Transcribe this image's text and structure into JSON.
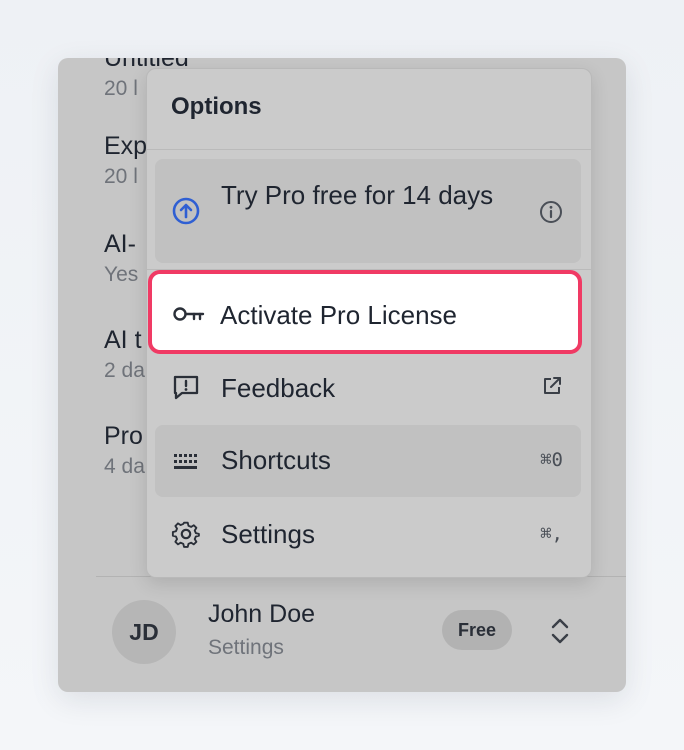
{
  "background_list": {
    "items": [
      {
        "title": "Untitled",
        "meta": "20 l"
      },
      {
        "title": "Exp",
        "meta": "20 l"
      },
      {
        "title": "AI-",
        "meta": "Yes"
      },
      {
        "title": "AI t",
        "meta": "2 da"
      },
      {
        "title": "Pro",
        "meta": "4 da"
      }
    ]
  },
  "user": {
    "initials": "JD",
    "name": "John Doe",
    "subtitle": "Settings",
    "plan": "Free"
  },
  "menu": {
    "header": "Options",
    "items": [
      {
        "label": "Try Pro free for 14 days",
        "icon": "arrow-up-circle-icon",
        "trail_icon": "info-icon"
      },
      {
        "label": "Activate Pro License",
        "icon": "key-icon"
      },
      {
        "label": "Feedback",
        "icon": "feedback-icon",
        "trail_icon": "external-link-icon"
      },
      {
        "label": "Shortcuts",
        "icon": "keyboard-icon",
        "shortcut": "⌘0"
      },
      {
        "label": "Settings",
        "icon": "gear-icon",
        "shortcut": "⌘,"
      }
    ]
  },
  "colors": {
    "accent": "#2f5fd3",
    "focus_ring": "#f03a64",
    "backdrop": "#c6c6c6"
  }
}
